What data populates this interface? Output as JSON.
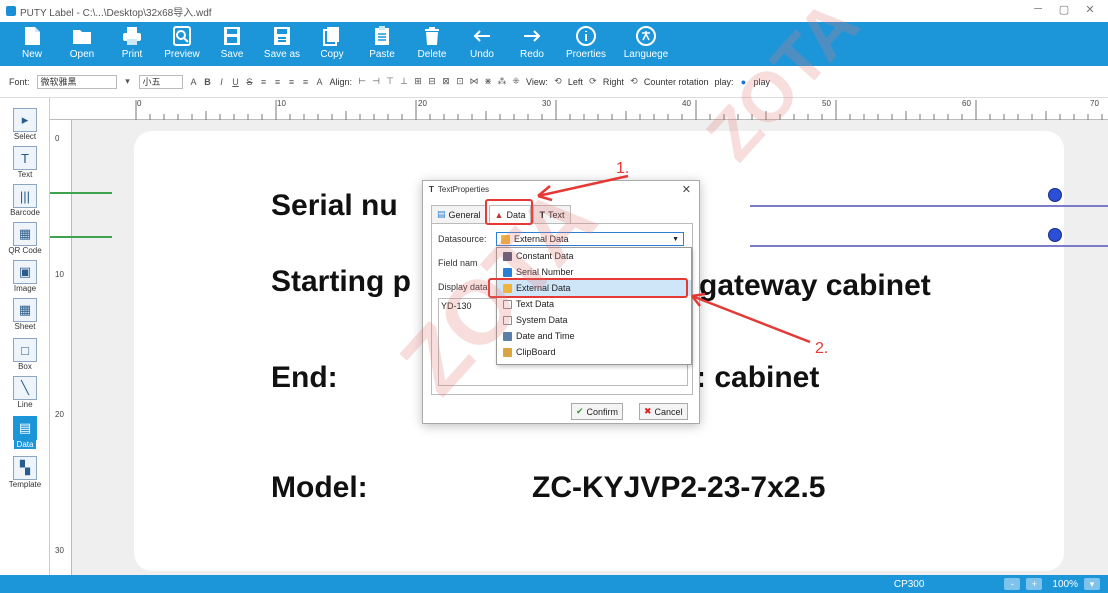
{
  "window": {
    "title": "PUTY Label - C:\\...\\Desktop\\32x68导入.wdf",
    "min_icon": "minimize-icon",
    "max_icon": "maximize-icon",
    "close_icon": "close-icon"
  },
  "toolbar": {
    "items": [
      {
        "label": "New",
        "icon": "new-file-icon"
      },
      {
        "label": "Open",
        "icon": "folder-icon"
      },
      {
        "label": "Print",
        "icon": "printer-icon"
      },
      {
        "label": "Preview",
        "icon": "preview-icon"
      },
      {
        "label": "Save",
        "icon": "save-icon"
      },
      {
        "label": "Save as",
        "icon": "save-as-icon"
      },
      {
        "label": "Copy",
        "icon": "copy-icon"
      },
      {
        "label": "Paste",
        "icon": "paste-icon"
      },
      {
        "label": "Delete",
        "icon": "trash-icon"
      },
      {
        "label": "Undo",
        "icon": "arrow-left-icon"
      },
      {
        "label": "Redo",
        "icon": "arrow-right-icon"
      },
      {
        "label": "Proerties",
        "icon": "info-icon"
      },
      {
        "label": "Languege",
        "icon": "language-icon"
      }
    ]
  },
  "formatbar": {
    "font_label": "Font:",
    "font_value": "微软雅黑",
    "size_value": "小五",
    "align_label": "Align:",
    "view_label": "View:",
    "left_label": "Left",
    "right_label": "Right",
    "counter_label": "Counter rotation",
    "play_label": "play:",
    "play_button": "play"
  },
  "ruler": {
    "top": [
      "0",
      "10",
      "20",
      "30",
      "40",
      "50",
      "60",
      "70"
    ],
    "left": [
      "0",
      "10",
      "20",
      "30"
    ]
  },
  "tools": [
    {
      "label": "Select",
      "glyph": "▸"
    },
    {
      "label": "Text",
      "glyph": "T"
    },
    {
      "label": "Barcode",
      "glyph": "|||"
    },
    {
      "label": "QR Code",
      "glyph": "▦"
    },
    {
      "label": "Image",
      "glyph": "▣"
    },
    {
      "label": "Sheet",
      "glyph": "▦"
    },
    {
      "label": "Box",
      "glyph": "□"
    },
    {
      "label": "Line",
      "glyph": "╲"
    },
    {
      "label": "Data",
      "glyph": "▤"
    },
    {
      "label": "Template",
      "glyph": "▚"
    }
  ],
  "label_content": {
    "serial": "Serial nu",
    "starting": "Starting p",
    "starting_tail": "gateway cabinet",
    "end": "End:",
    "end_tail": ": cabinet",
    "model": "Model:",
    "model_value": "ZC-KYJVP2-23-7x2.5"
  },
  "dialog": {
    "title": "TextProperties",
    "close": "✕",
    "tabs": [
      "General",
      "Data",
      "Text"
    ],
    "datasource_label": "Datasource:",
    "datasource_value": "External Data",
    "field_label": "Field nam",
    "display_label": "Display data",
    "display_value": "YD-130",
    "options": [
      "Constant Data",
      "Serial Number",
      "External Data",
      "Text Data",
      "System Data",
      "Date and Time",
      "ClipBoard"
    ],
    "confirm": "Confirm",
    "cancel": "Cancel"
  },
  "status": {
    "device": "CP300",
    "zoom": "100%",
    "minus": "-",
    "plus": "+"
  },
  "annotations": {
    "one": "1.",
    "two": "2."
  },
  "watermark": "ZOTA"
}
